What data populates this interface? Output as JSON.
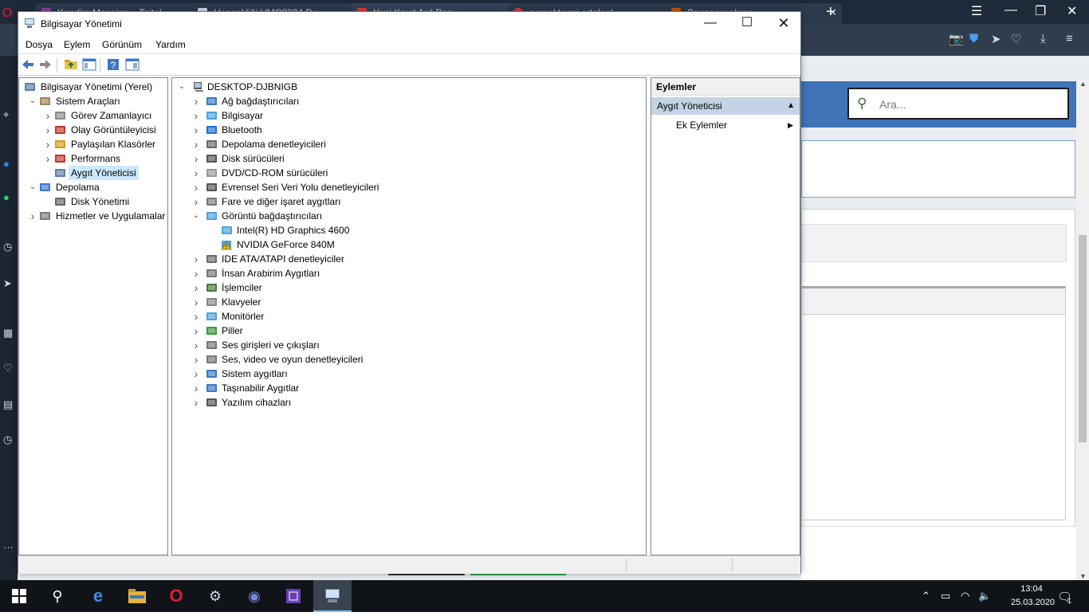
{
  "browser": {
    "tabs": [
      {
        "label": "Kendim Mesajım – Taitel",
        "color": "#8e44ad"
      },
      {
        "label": "Hesapkliği VMC8334 Pe",
        "color": "#d6dde6"
      },
      {
        "label": "Yeni Kayıt Ard Pan...",
        "color": "#e53935"
      },
      {
        "label": "gerçekte mi ortak el...",
        "color": "#e53935"
      },
      {
        "label": "Sayaç ve ekran...",
        "color": "#d35400"
      }
    ],
    "search_placeholder": "Ara..."
  },
  "window": {
    "title": "Bilgisayar Yönetimi",
    "menu": [
      "Dosya",
      "Eylem",
      "Görünüm",
      "Yardım"
    ]
  },
  "left_tree": [
    {
      "label": "Bilgisayar Yönetimi (Yerel)",
      "level": 0,
      "exp": "",
      "icon": "computer-mgmt-icon",
      "color": "#5b7fa8"
    },
    {
      "label": "Sistem Araçları",
      "level": 1,
      "exp": "down",
      "icon": "tools-icon",
      "color": "#a0845c"
    },
    {
      "label": "Görev Zamanlayıcı",
      "level": 2,
      "exp": "right",
      "icon": "clock-icon",
      "color": "#8a8a8a"
    },
    {
      "label": "Olay Görüntüleyicisi",
      "level": 2,
      "exp": "right",
      "icon": "event-viewer-icon",
      "color": "#c0392b"
    },
    {
      "label": "Paylaşılan Klasörler",
      "level": 2,
      "exp": "right",
      "icon": "shared-folder-icon",
      "color": "#d4a017"
    },
    {
      "label": "Performans",
      "level": 2,
      "exp": "right",
      "icon": "performance-icon",
      "color": "#c0392b"
    },
    {
      "label": "Aygıt Yöneticisi",
      "level": 2,
      "exp": "",
      "icon": "device-manager-icon",
      "color": "#5b7fa8",
      "selected": true
    },
    {
      "label": "Depolama",
      "level": 1,
      "exp": "down",
      "icon": "storage-icon",
      "color": "#3d78c4"
    },
    {
      "label": "Disk Yönetimi",
      "level": 2,
      "exp": "",
      "icon": "disk-mgmt-icon",
      "color": "#666666"
    },
    {
      "label": "Hizmetler ve Uygulamalar",
      "level": 1,
      "exp": "right",
      "icon": "services-icon",
      "color": "#7a7a7a"
    }
  ],
  "device_tree": {
    "root": "DESKTOP-DJBNIGB",
    "items": [
      {
        "label": "Ağ bağdaştırıcıları",
        "icon": "network-adapter-icon",
        "color": "#3d78c4",
        "exp": "right",
        "level": 1
      },
      {
        "label": "Bilgisayar",
        "icon": "computer-icon",
        "color": "#4aa3df",
        "exp": "right",
        "level": 1
      },
      {
        "label": "Bluetooth",
        "icon": "bluetooth-icon",
        "color": "#1e6fd9",
        "exp": "right",
        "level": 1
      },
      {
        "label": "Depolama denetleyicileri",
        "icon": "storage-controller-icon",
        "color": "#6b6b6b",
        "exp": "right",
        "level": 1
      },
      {
        "label": "Disk sürücüleri",
        "icon": "disk-drive-icon",
        "color": "#555555",
        "exp": "right",
        "level": 1
      },
      {
        "label": "DVD/CD-ROM sürücüleri",
        "icon": "dvd-icon",
        "color": "#9a9a9a",
        "exp": "right",
        "level": 1
      },
      {
        "label": "Evrensel Seri Veri Yolu denetleyicileri",
        "icon": "usb-icon",
        "color": "#555555",
        "exp": "right",
        "level": 1
      },
      {
        "label": "Fare ve diğer işaret aygıtları",
        "icon": "mouse-icon",
        "color": "#777777",
        "exp": "right",
        "level": 1
      },
      {
        "label": "Görüntü bağdaştırıcıları",
        "icon": "display-adapter-icon",
        "color": "#4aa3df",
        "exp": "down",
        "level": 1
      },
      {
        "label": "Intel(R) HD Graphics 4600",
        "icon": "display-adapter-icon",
        "color": "#4aa3df",
        "exp": "",
        "level": 2
      },
      {
        "label": "NVIDIA GeForce 840M",
        "icon": "warning-device-icon",
        "color": "#e6b800",
        "exp": "",
        "level": 2
      },
      {
        "label": "IDE ATA/ATAPI denetleyiciler",
        "icon": "ide-icon",
        "color": "#6b6b6b",
        "exp": "right",
        "level": 1
      },
      {
        "label": "İnsan Arabirim Aygıtları",
        "icon": "hid-icon",
        "color": "#777777",
        "exp": "right",
        "level": 1
      },
      {
        "label": "İşlemciler",
        "icon": "processor-icon",
        "color": "#4a7a3a",
        "exp": "right",
        "level": 1
      },
      {
        "label": "Klavyeler",
        "icon": "keyboard-icon",
        "color": "#888888",
        "exp": "right",
        "level": 1
      },
      {
        "label": "Monitörler",
        "icon": "monitor-icon",
        "color": "#4aa3df",
        "exp": "right",
        "level": 1
      },
      {
        "label": "Piller",
        "icon": "battery-icon",
        "color": "#3a9a3a",
        "exp": "right",
        "level": 1
      },
      {
        "label": "Ses girişleri ve çıkışları",
        "icon": "speaker-icon",
        "color": "#777777",
        "exp": "right",
        "level": 1
      },
      {
        "label": "Ses, video ve oyun denetleyicileri",
        "icon": "sound-controller-icon",
        "color": "#777777",
        "exp": "right",
        "level": 1
      },
      {
        "label": "Sistem aygıtları",
        "icon": "system-devices-icon",
        "color": "#3d78c4",
        "exp": "right",
        "level": 1
      },
      {
        "label": "Taşınabilir Aygıtlar",
        "icon": "portable-device-icon",
        "color": "#3d78c4",
        "exp": "right",
        "level": 1
      },
      {
        "label": "Yazılım cihazları",
        "icon": "software-device-icon",
        "color": "#555555",
        "exp": "right",
        "level": 1
      }
    ]
  },
  "actions": {
    "header": "Eylemler",
    "selected": "Aygıt Yöneticisi",
    "more": "Ek Eylemler"
  },
  "taskbar": {
    "time": "13:04",
    "date": "25.03.2020",
    "notif_count": "1"
  }
}
